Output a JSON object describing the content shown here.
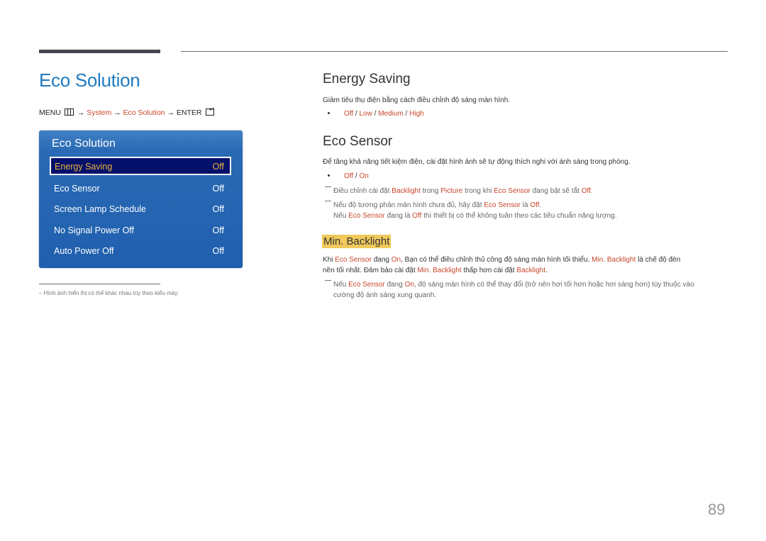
{
  "page": {
    "title": "Eco Solution",
    "page_number": "89"
  },
  "menu_path": {
    "menu": "MENU",
    "menu_icon": "menu-grid-icon",
    "arrow": "→",
    "system": "System",
    "eco_solution": "Eco Solution",
    "enter": "ENTER",
    "enter_icon": "enter-icon"
  },
  "osd": {
    "title": "Eco Solution",
    "items": [
      {
        "label": "Energy Saving",
        "value": "Off",
        "selected": true
      },
      {
        "label": "Eco Sensor",
        "value": "Off"
      },
      {
        "label": "Screen Lamp Schedule",
        "value": "Off"
      },
      {
        "label": "No Signal Power Off",
        "value": "Off"
      },
      {
        "label": "Auto Power Off",
        "value": "Off"
      }
    ]
  },
  "footnote": "–  Hình ảnh hiển thị có thể khác nhau tùy theo kiểu máy.",
  "energy_saving": {
    "heading": "Energy Saving",
    "desc": "Giảm tiêu thụ điện bằng cách điều chỉnh độ sáng màn hình.",
    "options": [
      "Off",
      "Low",
      "Medium",
      "High"
    ],
    "sep": " / "
  },
  "eco_sensor": {
    "heading": "Eco Sensor",
    "desc": "Để tăng khả năng tiết kiệm điện, cài đặt hình ảnh sẽ tự động thích nghi với ánh sáng trong phòng.",
    "options": [
      "Off",
      "On"
    ],
    "note1": {
      "t1": "Điều chỉnh cài đặt ",
      "k1": "Backlight",
      "t2": " trong ",
      "k2": "Picture",
      "t3": " trong khi ",
      "k3": "Eco Sensor",
      "t4": " đang bật sẽ tắt ",
      "k4": "Off",
      "t5": "."
    },
    "note2": {
      "t1": "Nếu độ tương phản màn hình chưa đủ, hãy đặt ",
      "k1": "Eco Sensor",
      "t2": " là ",
      "k2": "Off",
      "t3": ".",
      "t4": "Nếu ",
      "k3": "Eco Sensor",
      "t5": " đang là ",
      "k4": "Off",
      "t6": " thì thiết bị có thể không tuân theo các tiêu chuẩn năng lượng."
    }
  },
  "min_backlight": {
    "heading": "Min. Backlight",
    "para": {
      "t1": "Khi ",
      "k1": "Eco Sensor",
      "t2": " đang ",
      "k2": "On",
      "t3": ", Bạn có thể điều chỉnh thủ công độ sáng màn hình tối thiểu. ",
      "k3": "Min. Backlight",
      "t4": " là chế độ đèn",
      "t5": "nền tối nhất. Đảm bảo cài đặt ",
      "k4": "Min. Backlight",
      "t6": " thấp hơn cài đặt ",
      "k5": "Backlight",
      "t7": "."
    },
    "note": {
      "t1": "Nếu ",
      "k1": "Eco Sensor",
      "t2": " đang ",
      "k2": "On",
      "t3": ", độ sáng màn hình có thể thay đổi (trở nên hơi tối hơn hoặc hơi sáng hơn) tùy thuộc vào",
      "t4": "cường độ ánh sáng xung quanh."
    }
  },
  "colors": {
    "title_blue": "#1f7bc1",
    "highlight": "#c8462a",
    "osd_blue": "#2a6ab4",
    "osd_selected_bg": "#05106a",
    "osd_selected_text": "#e8b33a",
    "min_backlight_bg": "#f1c95b"
  }
}
